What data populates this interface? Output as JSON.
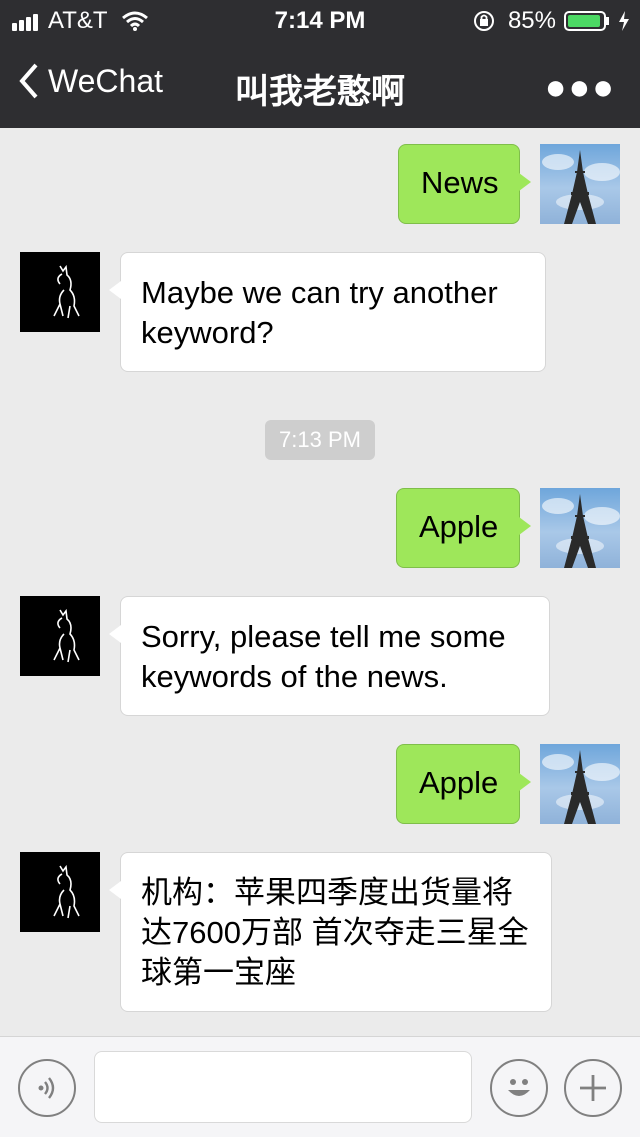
{
  "status": {
    "carrier": "AT&T",
    "time": "7:14 PM",
    "battery": "85%"
  },
  "nav": {
    "back_label": "WeChat",
    "title": "叫我老憨啊"
  },
  "messages": [
    {
      "side": "right",
      "text": "News"
    },
    {
      "side": "left",
      "text": "Maybe we can try another keyword?"
    },
    {
      "side": "system",
      "text": "7:13 PM"
    },
    {
      "side": "right",
      "text": "Apple"
    },
    {
      "side": "left",
      "text": "Sorry, please tell me some keywords of the news."
    },
    {
      "side": "right",
      "text": "Apple"
    },
    {
      "side": "left",
      "text": "机构：苹果四季度出货量将达7600万部 首次夺走三星全球第一宝座"
    }
  ],
  "colors": {
    "header_bg": "#2e2e31",
    "chat_bg": "#ebebeb",
    "sent_bubble": "#9ee75a",
    "received_bubble": "#ffffff",
    "battery": "#4cd964"
  },
  "icons": {
    "voice": "voice-icon",
    "emoji": "emoji-icon",
    "add": "plus-icon"
  }
}
